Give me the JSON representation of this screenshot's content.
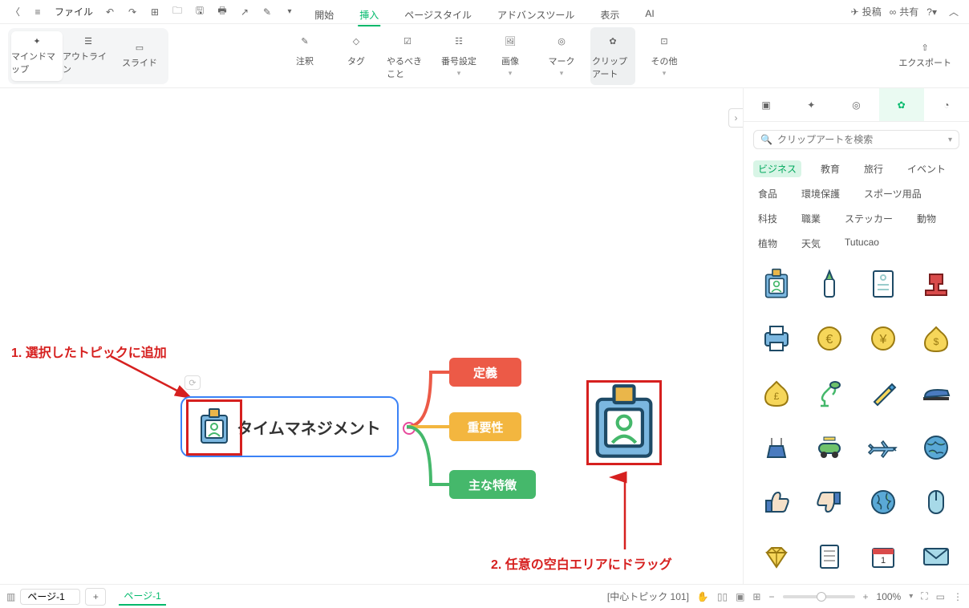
{
  "topbar": {
    "file_label": "ファイル",
    "post_label": "投稿",
    "share_label": "共有"
  },
  "menu": {
    "tabs": [
      "開始",
      "挿入",
      "ページスタイル",
      "アドバンスツール",
      "表示",
      "AI"
    ],
    "active_index": 1
  },
  "views": {
    "mindmap": "マインドマップ",
    "outline": "アウトライン",
    "slide": "スライド"
  },
  "ribbon": {
    "note": "注釈",
    "tag": "タグ",
    "todo": "やるべきこと",
    "numbering": "番号設定",
    "image": "画像",
    "mark": "マーク",
    "clipart": "クリップアート",
    "other": "その他",
    "export": "エクスポート"
  },
  "side": {
    "search_placeholder": "クリップアートを検索",
    "categories": [
      "ビジネス",
      "教育",
      "旅行",
      "イベント",
      "食品",
      "環境保護",
      "スポーツ用品",
      "科技",
      "職業",
      "ステッカー",
      "動物",
      "植物",
      "天気",
      "Tutucao"
    ],
    "active_category_index": 0
  },
  "canvas": {
    "central": "タイムマネジメント",
    "children": [
      "定義",
      "重要性",
      "主な特徴"
    ],
    "annotation1": "1. 選択したトピックに追加",
    "annotation2": "2. 任意の空白エリアにドラッグ"
  },
  "statusbar": {
    "page_name": "ページ-1",
    "tab_name": "ページ-1",
    "topic_info": "[中心トピック 101]",
    "zoom_label": "100%"
  }
}
